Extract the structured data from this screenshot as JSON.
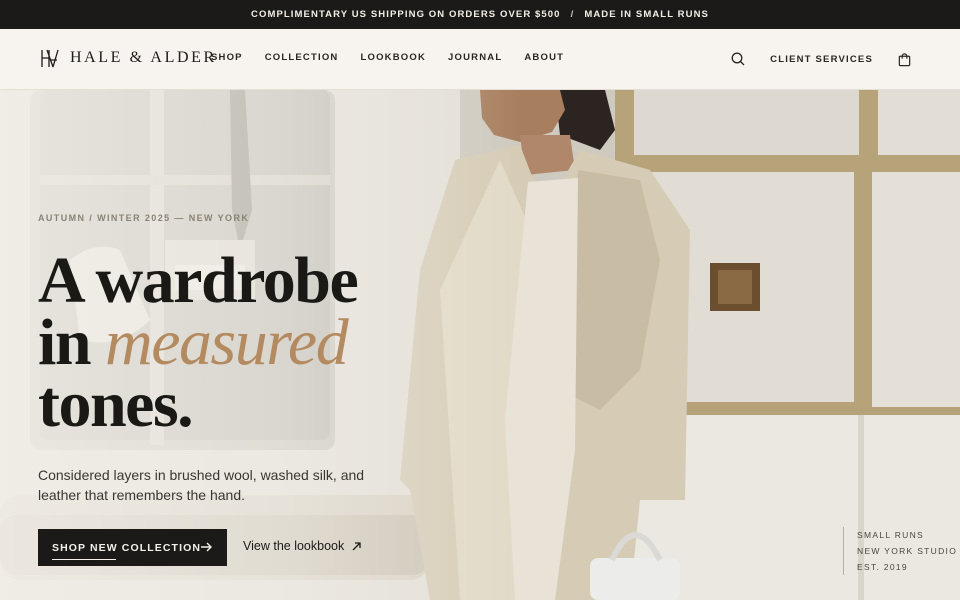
{
  "announcement": {
    "left": "COMPLIMENTARY US SHIPPING ON ORDERS OVER $500",
    "separator": "/",
    "right": "MADE IN SMALL RUNS"
  },
  "header": {
    "brand": "HALE & ALDER",
    "nav": [
      "SHOP",
      "COLLECTION",
      "LOOKBOOK",
      "JOURNAL",
      "ABOUT"
    ],
    "client_services": "CLIENT SERVICES",
    "icons": {
      "search": "search-icon",
      "bag": "shopping-bag-icon",
      "logo": "monogram-logo"
    }
  },
  "hero": {
    "eyebrow": "AUTUMN / WINTER 2025 — NEW YORK",
    "headline_line1": "A wardrobe",
    "headline_in": "in",
    "headline_italic": "measured",
    "headline_line3": "tones.",
    "description": "Considered layers in brushed wool, washed silk, and leather that remembers the hand.",
    "cta_primary": "SHOP NEW COLLECTION",
    "cta_secondary": "View the lookbook",
    "badge": [
      "SMALL RUNS",
      "NEW YORK STUDIO",
      "EST. 2019"
    ],
    "accent_color": "#b48a60"
  }
}
